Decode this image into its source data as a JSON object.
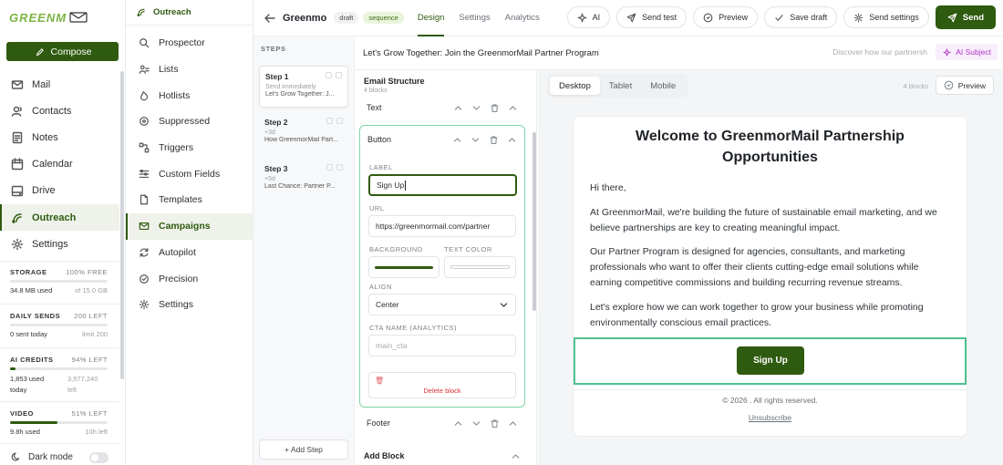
{
  "app": {
    "logo_text": "GREENM"
  },
  "compose_label": "Compose",
  "nav": [
    {
      "label": "Mail",
      "icon": "mail-icon",
      "active": false
    },
    {
      "label": "Contacts",
      "icon": "contacts-icon",
      "active": false
    },
    {
      "label": "Notes",
      "icon": "notes-icon",
      "active": false
    },
    {
      "label": "Calendar",
      "icon": "calendar-icon",
      "active": false
    },
    {
      "label": "Drive",
      "icon": "drive-icon",
      "active": false
    },
    {
      "label": "Outreach",
      "icon": "outreach-icon",
      "active": true
    },
    {
      "label": "Settings",
      "icon": "settings-icon",
      "active": false
    }
  ],
  "stats": {
    "storage": {
      "label": "STORAGE",
      "right": "100% FREE",
      "used": "34.8 MB used",
      "of": "of 15.0 GB",
      "fraction": 0.0
    },
    "daily": {
      "label": "DAILY SENDS",
      "right": "200 LEFT",
      "used": "0 sent today",
      "of": "limit 200",
      "fraction": 0.0
    },
    "ai": {
      "label": "AI CREDITS",
      "right": "94% LEFT",
      "used": "1,853 used today",
      "of": "3,577,240 left",
      "fraction": 0.06
    },
    "video": {
      "label": "VIDEO",
      "right": "51% LEFT",
      "used": "9.8h used",
      "of": "10h left",
      "fraction": 0.49
    }
  },
  "dark_mode_label": "Dark mode",
  "sub": {
    "title": "Outreach",
    "items": [
      {
        "label": "Prospector",
        "icon": "search-icon",
        "active": false
      },
      {
        "label": "Lists",
        "icon": "lists-icon",
        "active": false
      },
      {
        "label": "Hotlists",
        "icon": "flame-icon",
        "active": false
      },
      {
        "label": "Suppressed",
        "icon": "blocked-icon",
        "active": false
      },
      {
        "label": "Triggers",
        "icon": "triggers-icon",
        "active": false
      },
      {
        "label": "Custom Fields",
        "icon": "fields-icon",
        "active": false
      },
      {
        "label": "Templates",
        "icon": "template-icon",
        "active": false
      },
      {
        "label": "Campaigns",
        "icon": "campaign-icon",
        "active": true
      },
      {
        "label": "Autopilot",
        "icon": "autopilot-icon",
        "active": false
      },
      {
        "label": "Precision",
        "icon": "precision-icon",
        "active": false
      },
      {
        "label": "Settings",
        "icon": "settings-icon",
        "active": false
      }
    ]
  },
  "topbar": {
    "campaign_name": "Greenmo",
    "status_pill": "draft",
    "type_pill": "sequence",
    "tabs": [
      {
        "label": "Design",
        "active": true
      },
      {
        "label": "Settings",
        "active": false
      },
      {
        "label": "Analytics",
        "active": false
      }
    ],
    "actions": {
      "ai": "AI",
      "send_test": "Send test",
      "preview": "Preview",
      "save_draft": "Save draft",
      "send_settings": "Send settings",
      "send": "Send"
    }
  },
  "steps": {
    "title": "STEPS",
    "items": [
      {
        "title": "Step 1",
        "timing": "Send immediately",
        "preview": "Let's Grow Together: J...",
        "active": true
      },
      {
        "title": "Step 2",
        "timing": "+3d",
        "preview": "How GreenmorMail Part...",
        "active": false
      },
      {
        "title": "Step 3",
        "timing": "+5d",
        "preview": "Last Chance: Partner P...",
        "active": false
      }
    ],
    "add_label": "+ Add Step"
  },
  "subject": {
    "text": "Let's Grow Together: Join the GreenmorMail Partner Program",
    "preheader": "Discover how our partnersh",
    "ai_label": "AI Subject"
  },
  "structure": {
    "title": "Email Structure",
    "count": "4 blocks",
    "blocks": {
      "text": "Text",
      "button": "Button",
      "footer": "Footer"
    },
    "fields": {
      "label_label": "LABEL",
      "label_value": "Sign Up",
      "url_label": "URL",
      "url_value": "https://greenmormail.com/partner",
      "bg_label": "BACKGROUND",
      "bg_color": "#2f5b10",
      "textcolor_label": "TEXT COLOR",
      "text_color": "#ffffff",
      "align_label": "ALIGN",
      "align_value": "Center",
      "cta_label": "CTA NAME (ANALYTICS)",
      "cta_placeholder": "main_cta"
    },
    "delete_label": "Delete block",
    "add_block": "Add Block"
  },
  "preview": {
    "tabs": [
      {
        "label": "Desktop",
        "active": true
      },
      {
        "label": "Tablet",
        "active": false
      },
      {
        "label": "Mobile",
        "active": false
      }
    ],
    "blocks_count": "4 blocks",
    "preview_label": "Preview",
    "email": {
      "title": "Welcome to GreenmorMail Partnership Opportunities",
      "greeting": "Hi there,",
      "p1": "At GreenmorMail, we're building the future of sustainable email marketing, and we believe partnerships are key to creating meaningful impact.",
      "p2": "Our Partner Program is designed for agencies, consultants, and marketing professionals who want to offer their clients cutting-edge email solutions while earning competitive commissions and building recurring revenue streams.",
      "p3": "Let's explore how we can work together to grow your business while promoting environmentally conscious email practices.",
      "button": "Sign Up",
      "copyright": "© 2026 . All rights reserved.",
      "unsubscribe": "Unsubscribe"
    }
  },
  "colors": {
    "brand": "#2f5b10",
    "accent_green": "#7cb342",
    "highlight": "#4fc08d",
    "ai": "#b233c6"
  }
}
